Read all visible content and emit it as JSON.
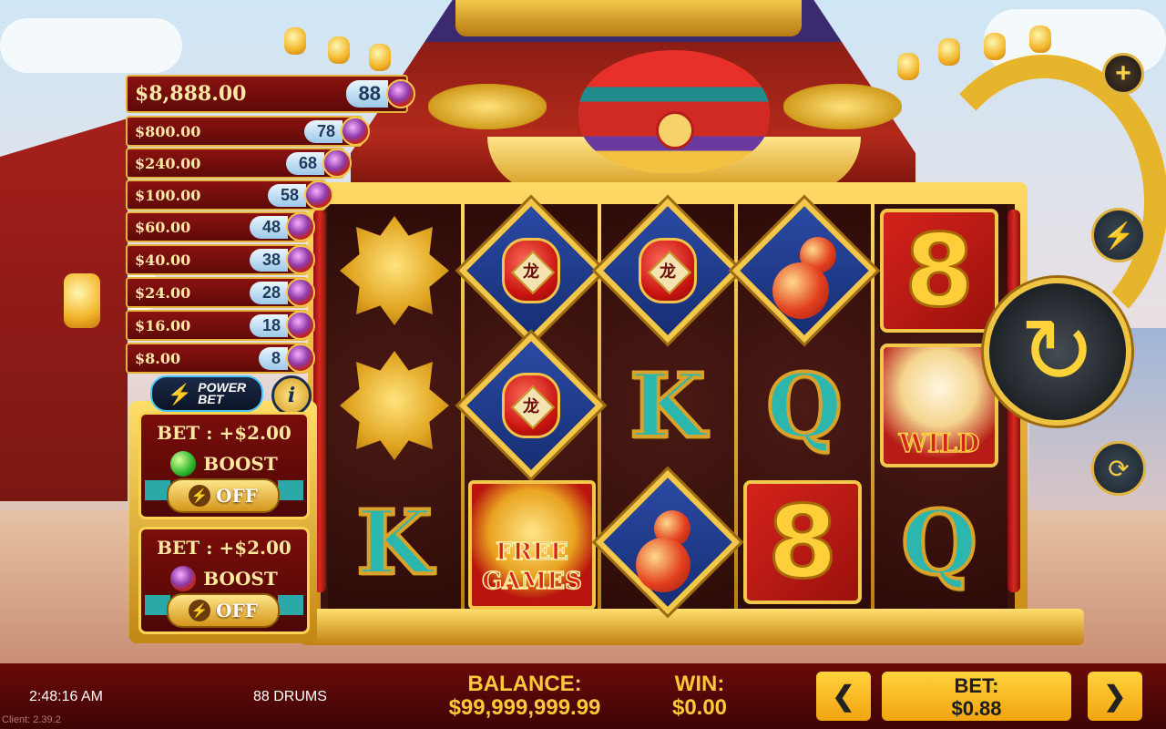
{
  "game": {
    "name": "88 DRUMS"
  },
  "jackpots": [
    {
      "amount": "$8,888.00",
      "count": "88"
    },
    {
      "amount": "$800.00",
      "count": "78"
    },
    {
      "amount": "$240.00",
      "count": "68"
    },
    {
      "amount": "$100.00",
      "count": "58"
    },
    {
      "amount": "$60.00",
      "count": "48"
    },
    {
      "amount": "$40.00",
      "count": "38"
    },
    {
      "amount": "$24.00",
      "count": "28"
    },
    {
      "amount": "$16.00",
      "count": "18"
    },
    {
      "amount": "$8.00",
      "count": "8"
    }
  ],
  "power_bet": {
    "logo_line1": "POWER",
    "logo_line2": "BET",
    "info_label": "i",
    "cards": [
      {
        "bet": "BET : +$2.00",
        "boost": "BOOST",
        "icon": "green-gem-icon",
        "toggle": "OFF"
      },
      {
        "bet": "BET : +$2.00",
        "boost": "BOOST",
        "icon": "drum-icon",
        "toggle": "OFF"
      }
    ]
  },
  "reels": {
    "symbols": [
      [
        "tiger",
        "tiger",
        "K"
      ],
      [
        "lantern",
        "lantern",
        "free-games"
      ],
      [
        "lantern",
        "K",
        "gourd"
      ],
      [
        "gourd",
        "Q",
        "8"
      ],
      [
        "8",
        "wild",
        "Q"
      ]
    ],
    "lantern_glyph": "龙",
    "letter_K": "K",
    "letter_Q": "Q",
    "eight": "8",
    "wild_label": "WILD",
    "free_games_line1": "FREE",
    "free_games_line2": "GAMES"
  },
  "controls": {
    "plus_icon": "+",
    "turbo_icon": "⚡",
    "spin_icon": "↻",
    "autoplay_icon": "⟳"
  },
  "status": {
    "time": "2:48:16 AM",
    "client": "Client: 2.39.2",
    "balance_label": "BALANCE:",
    "balance_value": "$99,999,999.99",
    "win_label": "WIN:",
    "win_value": "$0.00",
    "bet_label": "BET:",
    "bet_value": "$0.88",
    "prev_arrow": "❮",
    "next_arrow": "❯"
  }
}
